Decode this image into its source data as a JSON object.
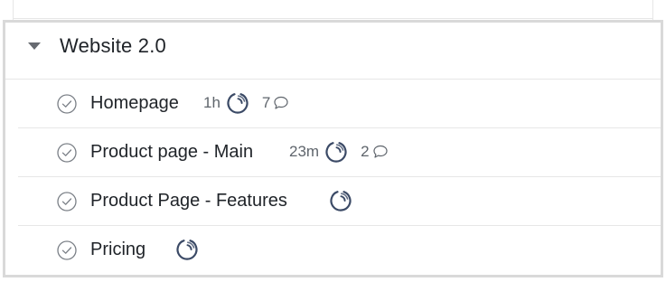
{
  "group": {
    "title": "Website 2.0",
    "expanded": true
  },
  "tasks": [
    {
      "label": "Homepage",
      "time": "1h",
      "comments": "7"
    },
    {
      "label": "Product page - Main",
      "time": "23m",
      "comments": "2"
    },
    {
      "label": "Product Page - Features",
      "time": "",
      "comments": ""
    },
    {
      "label": "Pricing",
      "time": "",
      "comments": ""
    }
  ],
  "icons": {
    "collapse": "caret-down-icon",
    "complete": "check-circle-icon",
    "progress": "progress-ring-icon",
    "comment": "speech-bubble-icon"
  },
  "colors": {
    "text": "#1f2328",
    "muted": "#5f656c",
    "progress": "#3b4a66"
  }
}
